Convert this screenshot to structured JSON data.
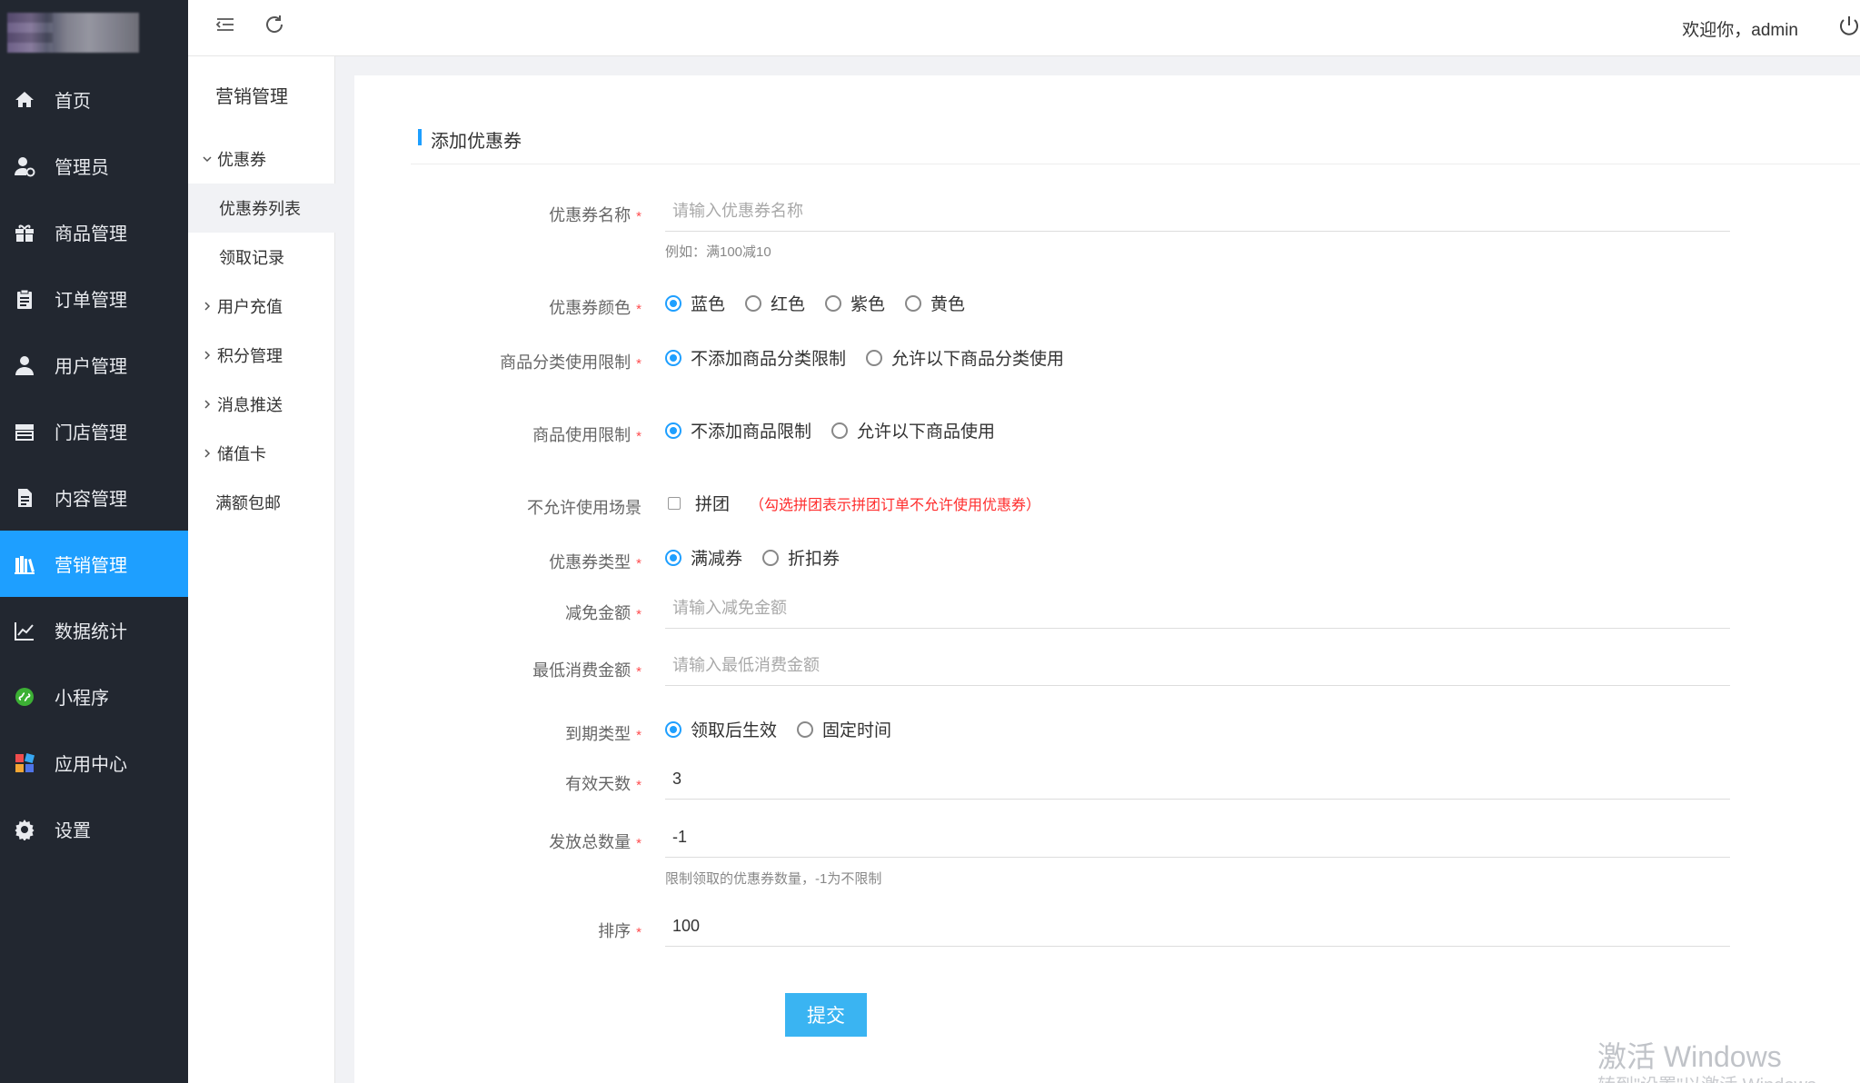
{
  "header": {
    "welcome_text": "欢迎你，admin"
  },
  "sidebar": {
    "items": [
      {
        "label": "首页",
        "icon": "home-icon"
      },
      {
        "label": "管理员",
        "icon": "admin-user-icon"
      },
      {
        "label": "商品管理",
        "icon": "gift-icon"
      },
      {
        "label": "订单管理",
        "icon": "clipboard-icon"
      },
      {
        "label": "用户管理",
        "icon": "user-icon"
      },
      {
        "label": "门店管理",
        "icon": "store-icon"
      },
      {
        "label": "内容管理",
        "icon": "document-icon"
      },
      {
        "label": "营销管理",
        "icon": "books-icon",
        "active": true
      },
      {
        "label": "数据统计",
        "icon": "line-chart-icon"
      },
      {
        "label": "小程序",
        "icon": "mini-program-icon"
      },
      {
        "label": "应用中心",
        "icon": "apps-icon"
      },
      {
        "label": "设置",
        "icon": "gear-icon"
      }
    ],
    "active_color": "#1e9fff"
  },
  "submenu": {
    "title": "营销管理",
    "items": [
      {
        "label": "优惠券",
        "expanded": true
      },
      {
        "label": "优惠券列表",
        "selected": true
      },
      {
        "label": "领取记录"
      },
      {
        "label": "用户充值"
      },
      {
        "label": "积分管理"
      },
      {
        "label": "消息推送"
      },
      {
        "label": "储值卡"
      },
      {
        "label": "满额包邮"
      }
    ]
  },
  "form": {
    "title": "添加优惠券",
    "name": {
      "label": "优惠券名称",
      "placeholder": "请输入优惠券名称",
      "hint": "例如：满100减10"
    },
    "color": {
      "label": "优惠券颜色",
      "options": [
        "蓝色",
        "红色",
        "紫色",
        "黄色"
      ],
      "selected": "蓝色"
    },
    "category_limit": {
      "label": "商品分类使用限制",
      "options": [
        "不添加商品分类限制",
        "允许以下商品分类使用"
      ],
      "selected": "不添加商品分类限制"
    },
    "goods_limit": {
      "label": "商品使用限制",
      "options": [
        "不添加商品限制",
        "允许以下商品使用"
      ],
      "selected": "不添加商品限制"
    },
    "scene": {
      "label": "不允许使用场景",
      "checkbox_label": "拼团",
      "checked": false,
      "note": "（勾选拼团表示拼团订单不允许使用优惠券）"
    },
    "type": {
      "label": "优惠券类型",
      "options": [
        "满减券",
        "折扣券"
      ],
      "selected": "满减券"
    },
    "discount": {
      "label": "减免金额",
      "placeholder": "请输入减免金额"
    },
    "min_spend": {
      "label": "最低消费金额",
      "placeholder": "请输入最低消费金额"
    },
    "expire_type": {
      "label": "到期类型",
      "options": [
        "领取后生效",
        "固定时间"
      ],
      "selected": "领取后生效"
    },
    "valid_days": {
      "label": "有效天数",
      "value": "3"
    },
    "total": {
      "label": "发放总数量",
      "value": "-1",
      "hint": "限制领取的优惠券数量，-1为不限制"
    },
    "sort": {
      "label": "排序",
      "value": "100"
    },
    "required_mark": "*",
    "submit_label": "提交"
  },
  "watermark": {
    "line1": "激活 Windows",
    "line2": "转到\"设置\"以激活 Windows。"
  }
}
